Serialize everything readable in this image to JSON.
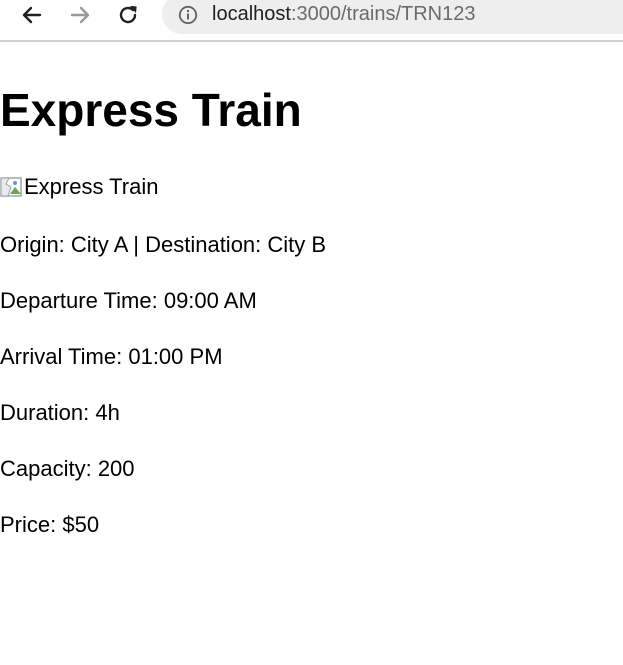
{
  "browser": {
    "back_icon": "arrow-left-icon",
    "forward_icon": "arrow-right-icon",
    "reload_icon": "reload-icon",
    "site_info_icon": "info-icon",
    "url_host": "localhost",
    "url_path": ":3000/trains/TRN123"
  },
  "page": {
    "title": "Express Train",
    "image_alt": "Express Train",
    "details": {
      "route": "Origin: City A | Destination: City B",
      "departure": "Departure Time: 09:00 AM",
      "arrival": "Arrival Time: 01:00 PM",
      "duration": "Duration: 4h",
      "capacity": "Capacity: 200",
      "price": "Price: $50"
    }
  }
}
